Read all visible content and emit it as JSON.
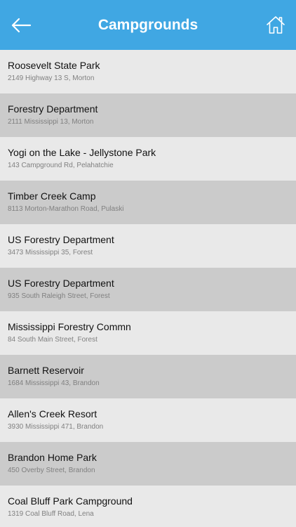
{
  "header": {
    "title": "Campgrounds",
    "back_icon": "arrow-left-icon",
    "home_icon": "home-icon"
  },
  "colors": {
    "navbar": "#40a7e3",
    "row_light": "#e9e9e9",
    "row_dark": "#cbcbcb"
  },
  "campgrounds": [
    {
      "name": "Roosevelt State Park",
      "address": "2149 Highway 13 S, Morton"
    },
    {
      "name": "Forestry Department",
      "address": "2111 Mississippi 13, Morton"
    },
    {
      "name": "Yogi on the Lake - Jellystone Park",
      "address": "143 Campground Rd, Pelahatchie"
    },
    {
      "name": "Timber Creek Camp",
      "address": "8113 Morton-Marathon Road, Pulaski"
    },
    {
      "name": "US Forestry Department",
      "address": "3473 Mississippi 35, Forest"
    },
    {
      "name": "US Forestry Department",
      "address": "935 South Raleigh Street, Forest"
    },
    {
      "name": "Mississippi Forestry Commn",
      "address": "84 South Main Street, Forest"
    },
    {
      "name": "Barnett Reservoir",
      "address": "1684 Mississippi 43, Brandon"
    },
    {
      "name": "Allen's Creek Resort",
      "address": "3930 Mississippi 471, Brandon"
    },
    {
      "name": "Brandon Home Park",
      "address": "450 Overby Street, Brandon"
    },
    {
      "name": "Coal Bluff Park Campground",
      "address": "1319 Coal Bluff Road, Lena"
    }
  ]
}
